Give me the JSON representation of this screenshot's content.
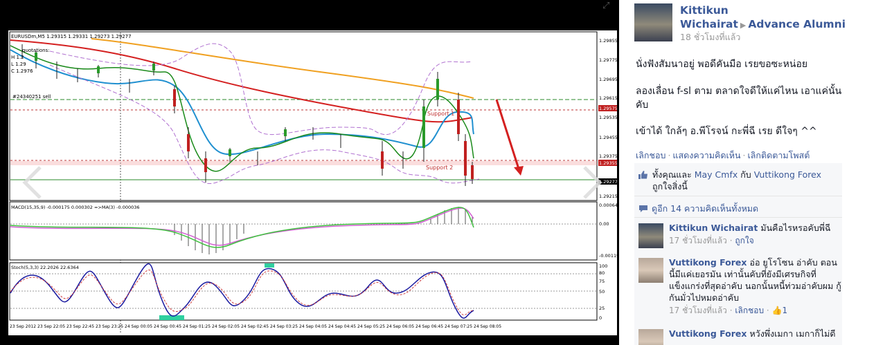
{
  "post": {
    "author_name": "Kittikun Wichairat",
    "target_name": "Advance Alumni",
    "time": "18 ชั่วโมงที่แล้ว",
    "lines": [
      "นั่งฟังสัมนาอยู่ พอดีคันมือ เรยขอซะหน่อย",
      "ลองเลื่อน f-sl ตาม ตลาดใจดีให้แค่ไหน เอาแค่นั้นคับ",
      "เข้าได้ ใกล้ๆ อ.พีโรจน์ กะพี่ฉี เรย ดีใจๆ ^^"
    ],
    "actions": [
      "เลิกชอบ",
      "แสดงความคิดเห็น",
      "เลิกติดตามโพสต์"
    ]
  },
  "likes": {
    "prefix": "ทั้งคุณและ",
    "name1": "May Cmfx",
    "joiner": "กับ",
    "name2": "Vuttikong Forex",
    "suffix": "ถูกใจสิ่งนี้"
  },
  "view_all_comments": "ดูอีก 14 ความคิดเห็นทั้งหมด",
  "comments": [
    {
      "name": "Kittikun Wichairat",
      "text": "มันคือไรหรอคับพี่ฉี",
      "time": "17 ชั่วโมงที่แล้ว",
      "action": "ถูกใจ",
      "likes": ""
    },
    {
      "name": "Vuttikong Forex",
      "text": "อ่อ ยูโรโซน อ่าคับ ตอนนี้มีแค่เยอรมัน เท่านั้นคับที่ยังมีเศรษกิจที่แข็งแกร่งที่สุดอ่าคับ นอกนั้นหนี้ท่วมอ่าคับผม กู้กันมั่วไปหมดอ่าคับ",
      "time": "17 ชั่วโมงที่แล้ว",
      "action": "เลิกชอบ",
      "likes": "1"
    },
    {
      "name": "Vuttikong Forex",
      "text": "หวังพึ่งเมกา เมกาก็ไม่ดี",
      "time": "",
      "action": "",
      "likes": ""
    }
  ],
  "chart": {
    "header": "EURUSDm,M5  1.29315 1.29331 1.29273 1.29277",
    "quotations": "quotations:",
    "ohl_lines": [
      "H 1.2",
      "L 1.29",
      "C 1.2976"
    ],
    "order_label": "#24340251 sell",
    "support1": "Support 1",
    "support2": "Support 2",
    "price_ticks": [
      "1.29855",
      "1.29775",
      "1.29695",
      "1.29615",
      "1.29575",
      "1.29535",
      "1.29455",
      "1.29375",
      "1.29355",
      "1.29277",
      "1.29215"
    ],
    "macd_label": "MACD(15,35,9) -0.000175 0.000302  =>MA(3) -0.000036",
    "macd_ticks": [
      "0.000644",
      "0.00",
      "-0.00119"
    ],
    "stoch_label": "Stoch(5,3,3) 22.2026 22.6364",
    "stoch_ticks": [
      "100",
      "80",
      "75",
      "50",
      "25",
      "0"
    ],
    "time_ticks": [
      "23 Sep 2012",
      "23 Sep 22:05",
      "23 Sep 22:45",
      "23 Sep 23:25",
      "24 Sep 00:05",
      "24 Sep 00:45",
      "24 Sep 01:25",
      "24 Sep 02:05",
      "24 Sep 02:45",
      "24 Sep 03:25",
      "24 Sep 04:05",
      "24 Sep 04:45",
      "24 Sep 05:25",
      "24 Sep 06:05",
      "24 Sep 06:45",
      "24 Sep 07:25",
      "24 Sep 08:05"
    ]
  }
}
